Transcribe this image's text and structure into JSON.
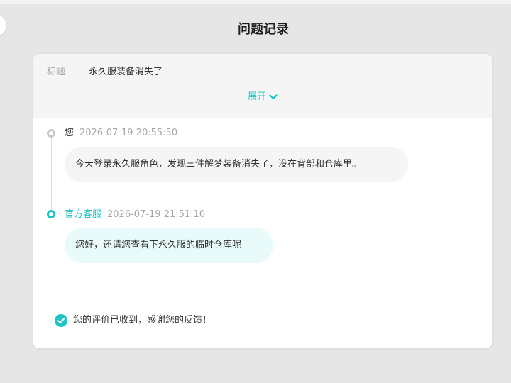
{
  "header": {
    "title": "问题记录"
  },
  "ticket": {
    "title_label": "标题",
    "title_value": "永久服装备消失了",
    "expand_label": "展开"
  },
  "messages": [
    {
      "sender": "您",
      "time": "2026-07-19 20:55:50",
      "text": "今天登录永久服角色，发现三件解梦装备消失了，没在背部和仓库里。"
    },
    {
      "sender": "官方客服",
      "time": "2026-07-19 21:51:10",
      "text": "您好，还请您查看下永久服的临时仓库呢"
    }
  ],
  "rating": {
    "text": "您的评价已收到，感谢您的反馈！"
  },
  "colors": {
    "accent": "#1cc4c4",
    "background": "#e6e6e6",
    "card": "#ffffff",
    "muted_text": "#a6a6a6"
  },
  "icons": {
    "expand": "chevron-down-icon",
    "rating": "check-circle-icon",
    "back": "back-icon"
  }
}
